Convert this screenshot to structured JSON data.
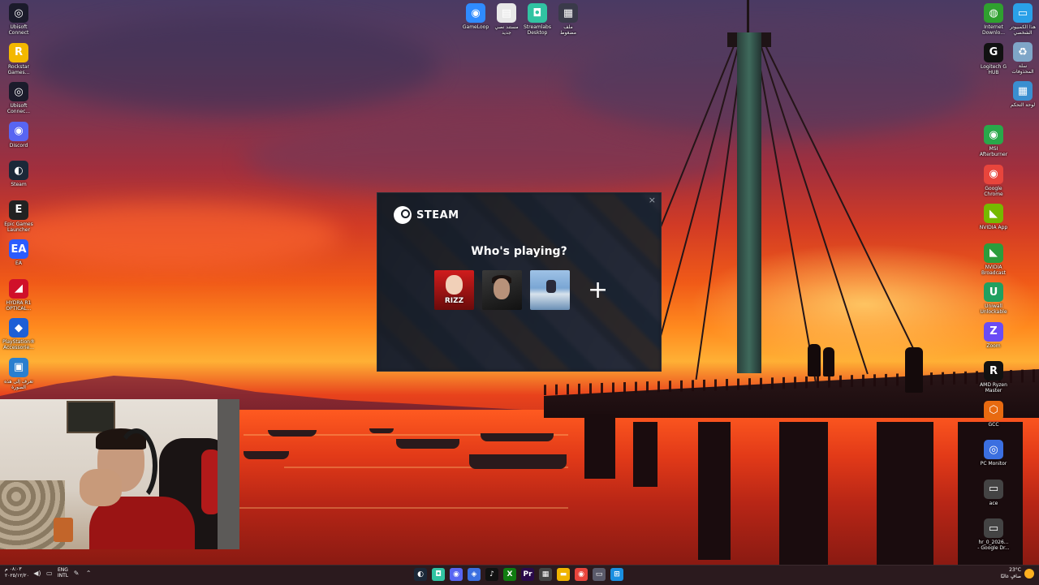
{
  "desktop_left": [
    {
      "label": "Ubisoft\nConnect",
      "glyph": "◎",
      "color": "#1b1b2b",
      "icon": "ubisoft-icon"
    },
    {
      "label": "Rockstar\nGames...",
      "glyph": "R",
      "color": "#f3b800",
      "icon": "rockstar-icon"
    },
    {
      "label": "Ubisoft\nConnec...",
      "glyph": "◎",
      "color": "#1b1b2b",
      "icon": "ubisoft-icon"
    },
    {
      "label": "Discord",
      "glyph": "◉",
      "color": "#5865f2",
      "icon": "discord-icon"
    },
    {
      "label": "Steam",
      "glyph": "◐",
      "color": "#1b2838",
      "icon": "steam-icon"
    },
    {
      "label": "Epic Games\nLauncher",
      "glyph": "E",
      "color": "#222222",
      "icon": "epic-games-icon"
    },
    {
      "label": "EA",
      "glyph": "EA",
      "color": "#2b5cff",
      "icon": "ea-icon"
    },
    {
      "label": "HYDRA R1\nOPTICAL...",
      "glyph": "◢",
      "color": "#d0102a",
      "icon": "hydra-icon"
    },
    {
      "label": "PlayStation®\nAccessorie...",
      "glyph": "◆",
      "color": "#1d5fd6",
      "icon": "playstation-accessories-icon"
    },
    {
      "label": "تعرف إلى هذه\nالصورة",
      "glyph": "▣",
      "color": "#2a7fcf",
      "icon": "spotlight-icon"
    }
  ],
  "desktop_top": [
    {
      "label": "GameLoop",
      "glyph": "◉",
      "color": "#2f8bff",
      "icon": "gameloop-icon"
    },
    {
      "label": "مستند نصي\nجديد",
      "glyph": "▤",
      "color": "#e8e8e8",
      "icon": "text-document-icon"
    },
    {
      "label": "Streamlabs\nDesktop",
      "glyph": "◘",
      "color": "#31c3a2",
      "icon": "streamlabs-icon"
    },
    {
      "label": "ملف\nمضغوط",
      "glyph": "▦",
      "color": "#3a3a4a",
      "icon": "archive-icon"
    }
  ],
  "desktop_right": [
    {
      "label": "Internet\nDownlo...",
      "glyph": "◍",
      "color": "#2fa02f",
      "icon": "internet-download-manager-icon"
    },
    {
      "label": "Logitech G\nHUB",
      "glyph": "G",
      "color": "#111111",
      "icon": "logitech-ghub-icon"
    },
    {
      "label": "MSI\nAfterburner",
      "glyph": "◉",
      "color": "#29a84a",
      "icon": "msi-afterburner-icon"
    },
    {
      "label": "Google\nChrome",
      "glyph": "◉",
      "color": "#e8453c",
      "icon": "chrome-icon"
    },
    {
      "label": "NVIDIA App",
      "glyph": "◣",
      "color": "#76b900",
      "icon": "nvidia-app-icon"
    },
    {
      "label": "NVIDIA\nBroadcast",
      "glyph": "◣",
      "color": "#2c9c3c",
      "icon": "nvidia-broadcast-icon"
    },
    {
      "label": "Uniwall\nUnlockable",
      "glyph": "U",
      "color": "#20a060",
      "icon": "uniwall-icon"
    },
    {
      "label": "Zoom",
      "glyph": "Z",
      "color": "#6a4cf5",
      "icon": "zoom-icon"
    },
    {
      "label": "AMD Ryzen\nMaster",
      "glyph": "R",
      "color": "#111111",
      "icon": "ryzen-master-icon"
    },
    {
      "label": "GCC",
      "glyph": "⬡",
      "color": "#e86a10",
      "icon": "gcc-icon"
    },
    {
      "label": "PC Monitor",
      "glyph": "◎",
      "color": "#3b6fe0",
      "icon": "pc-monitor-icon"
    },
    {
      "label": "ace",
      "glyph": "▭",
      "color": "#444444",
      "icon": "file-icon"
    },
    {
      "label": "hr_0_2026...\n- Google Dr...",
      "glyph": "▭",
      "color": "#444444",
      "icon": "file-icon"
    }
  ],
  "desktop_far_right": [
    {
      "label": "هذا الكمبيوتر\nالشخصي",
      "glyph": "▭",
      "color": "#2aa0e8",
      "icon": "this-pc-icon"
    },
    {
      "label": "سلة\nالمحذوفات",
      "glyph": "♻",
      "color": "#7fa6c8",
      "icon": "recycle-bin-icon"
    },
    {
      "label": "لوحة التحكم",
      "glyph": "▦",
      "color": "#3a8fd0",
      "icon": "control-panel-icon"
    }
  ],
  "steam": {
    "brand": "STEAM",
    "close": "×",
    "heading": "Who's playing?",
    "profile1_tag": "RIZZ",
    "add": "+"
  },
  "taskbar": {
    "time": "٠٨:٠٣ م",
    "date": "٢٠٢٥/١٢/٢٠",
    "lang_top": "ENG",
    "lang_bottom": "INTL",
    "weather_temp": "23°C",
    "weather_desc": "صافٍ غالبًا",
    "apps": [
      {
        "glyph": "◐",
        "color": "#1b2838",
        "name": "taskbar-steam"
      },
      {
        "glyph": "◘",
        "color": "#31c3a2",
        "name": "taskbar-streamlabs"
      },
      {
        "glyph": "◉",
        "color": "#5865f2",
        "name": "taskbar-discord"
      },
      {
        "glyph": "◈",
        "color": "#3b6fe0",
        "name": "taskbar-settings"
      },
      {
        "glyph": "♪",
        "color": "#111111",
        "name": "taskbar-tiktok"
      },
      {
        "glyph": "X",
        "color": "#107c10",
        "name": "taskbar-xbox"
      },
      {
        "glyph": "Pr",
        "color": "#2a0a4a",
        "name": "taskbar-premiere"
      },
      {
        "glyph": "▦",
        "color": "#444444",
        "name": "taskbar-calendar"
      },
      {
        "glyph": "▬",
        "color": "#f0b400",
        "name": "taskbar-file-explorer"
      },
      {
        "glyph": "◉",
        "color": "#e8453c",
        "name": "taskbar-chrome"
      },
      {
        "glyph": "▭",
        "color": "#5a5a6a",
        "name": "taskbar-window"
      },
      {
        "glyph": "⊞",
        "color": "#1a8fe0",
        "name": "taskbar-start"
      }
    ]
  }
}
